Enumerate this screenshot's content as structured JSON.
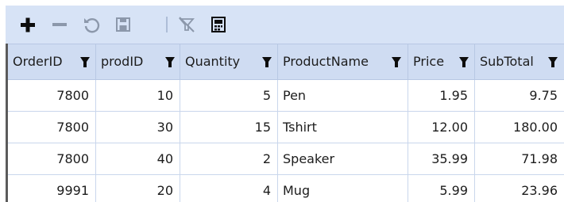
{
  "toolbar": {
    "icons": [
      "add-icon",
      "remove-icon",
      "refresh-icon",
      "save-icon",
      "no-filter-icon",
      "export-icon"
    ],
    "accent": "#d7e3f6"
  },
  "grid": {
    "columns": [
      "OrderID",
      "prodID",
      "Quantity",
      "ProductName",
      "Price",
      "SubTotal"
    ],
    "rows": [
      [
        "7800",
        "10",
        "5",
        "Pen",
        "1.95",
        "9.75"
      ],
      [
        "7800",
        "30",
        "15",
        "Tshirt",
        "12.00",
        "180.00"
      ],
      [
        "7800",
        "40",
        "2",
        "Speaker",
        "35.99",
        "71.98"
      ],
      [
        "9991",
        "20",
        "4",
        "Mug",
        "5.99",
        "23.96"
      ]
    ],
    "header_color": "#cfdcf2",
    "grid_line_color": "#c9d6ec"
  }
}
